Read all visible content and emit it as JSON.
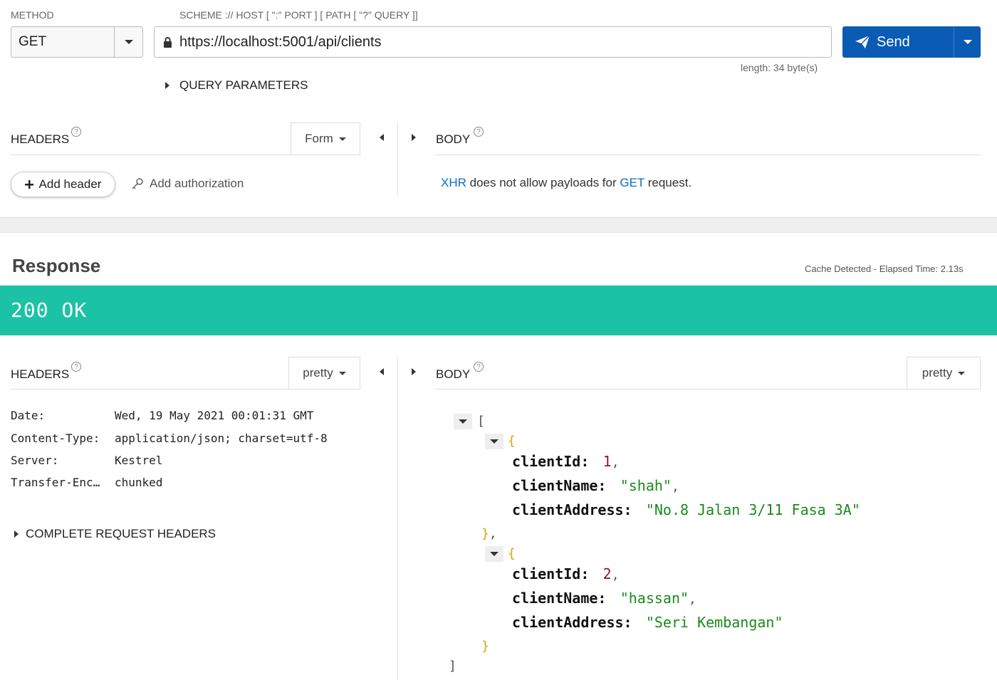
{
  "request": {
    "method_label": "METHOD",
    "url_label": "SCHEME :// HOST [ \":\" PORT ] [ PATH [ \"?\" QUERY ]]",
    "method": "GET",
    "url": "https://localhost:5001/api/clients",
    "send_label": "Send",
    "length_text": "length: 34 byte(s)",
    "query_params_label": "QUERY PARAMETERS",
    "headers_label": "HEADERS",
    "headers_mode": "Form",
    "add_header_label": "Add header",
    "add_auth_label": "Add authorization",
    "body_label": "BODY",
    "body_msg": {
      "xhr": "XHR",
      "mid": " does not allow payloads for ",
      "get": "GET",
      "end": " request."
    }
  },
  "response": {
    "title": "Response",
    "meta": "Cache Detected - Elapsed Time: 2.13s",
    "status": "200 OK",
    "headers_label": "HEADERS",
    "headers_mode": "pretty",
    "body_label": "BODY",
    "body_mode": "pretty",
    "headers": [
      {
        "key": "Date:",
        "value": "Wed, 19 May 2021 00:01:31 GMT"
      },
      {
        "key": "Content-Type:",
        "value": "application/json; charset=utf-8"
      },
      {
        "key": "Server:",
        "value": "Kestrel"
      },
      {
        "key": "Transfer-Enc…",
        "value": "chunked"
      }
    ],
    "complete_headers_label": "COMPLETE REQUEST HEADERS",
    "body": [
      {
        "clientId": "1",
        "clientName": "\"shah\"",
        "clientAddress": "\"No.8 Jalan 3/11 Fasa 3A\""
      },
      {
        "clientId": "2",
        "clientName": "\"hassan\"",
        "clientAddress": "\"Seri Kembangan\""
      }
    ],
    "keys": {
      "id": "clientId:",
      "name": "clientName:",
      "address": "clientAddress:"
    }
  },
  "colors": {
    "send": "#0a5bb4",
    "status_ok": "#1bc2a5",
    "link": "#0a6fc2"
  }
}
